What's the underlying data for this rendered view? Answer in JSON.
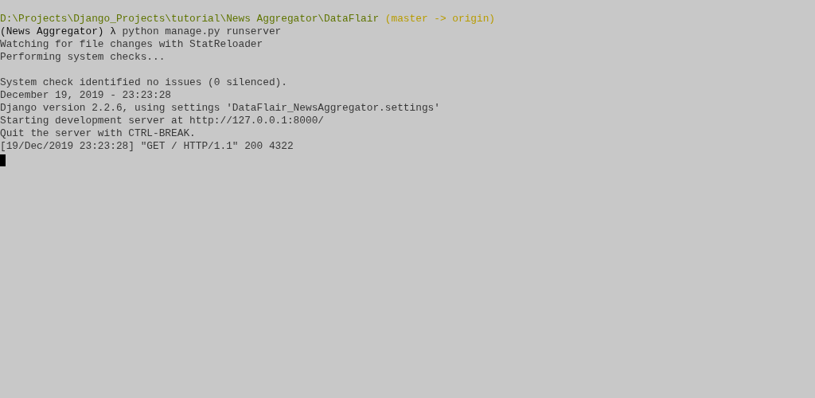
{
  "terminal": {
    "lines": [
      {
        "kind": "text",
        "segments": [
          {
            "kind": "path",
            "text": "D:\\Projects\\Django_Projects\\tutorial\\News Aggregator\\DataFlair"
          },
          {
            "kind": "branch",
            "text": " (master -> origin)"
          }
        ]
      },
      {
        "kind": "text",
        "segments": [
          {
            "kind": "prompt",
            "text": "(News Aggregator) λ"
          },
          {
            "kind": "output",
            "text": " python manage.py runserver"
          }
        ]
      },
      {
        "kind": "text",
        "segments": [
          {
            "kind": "output",
            "text": "Watching for file changes with StatReloader"
          }
        ]
      },
      {
        "kind": "text",
        "segments": [
          {
            "kind": "output",
            "text": "Performing system checks..."
          }
        ]
      },
      {
        "kind": "blank"
      },
      {
        "kind": "text",
        "segments": [
          {
            "kind": "output",
            "text": "System check identified no issues (0 silenced)."
          }
        ]
      },
      {
        "kind": "text",
        "segments": [
          {
            "kind": "output",
            "text": "December 19, 2019 - 23:23:28"
          }
        ]
      },
      {
        "kind": "text",
        "segments": [
          {
            "kind": "output",
            "text": "Django version 2.2.6, using settings 'DataFlair_NewsAggregator.settings'"
          }
        ]
      },
      {
        "kind": "text",
        "segments": [
          {
            "kind": "output",
            "text": "Starting development server at http://127.0.0.1:8000/"
          }
        ]
      },
      {
        "kind": "text",
        "segments": [
          {
            "kind": "output",
            "text": "Quit the server with CTRL-BREAK."
          }
        ]
      },
      {
        "kind": "text",
        "segments": [
          {
            "kind": "output",
            "text": "[19/Dec/2019 23:23:28] \"GET / HTTP/1.1\" 200 4322"
          }
        ]
      },
      {
        "kind": "cursor"
      }
    ]
  }
}
